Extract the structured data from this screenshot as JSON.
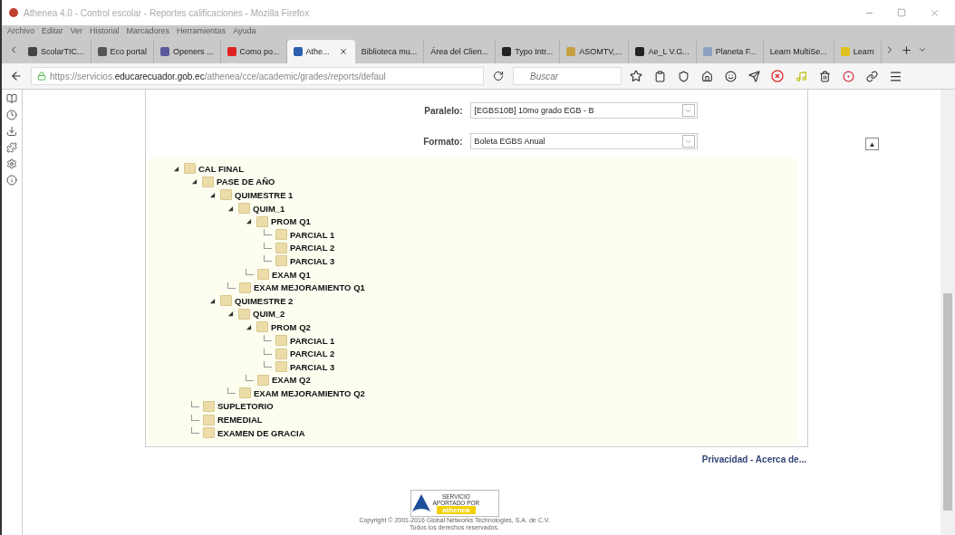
{
  "window": {
    "title": "Athenea 4.0 - Control escolar - Reportes calificaciones - Mozilla Firefox"
  },
  "menu": [
    "Archivo",
    "Editar",
    "Ver",
    "Historial",
    "Marcadores",
    "Herramientas",
    "Ayuda"
  ],
  "tabs": [
    {
      "label": "ScolarTIC...",
      "selected": false,
      "color": "#444444"
    },
    {
      "label": "Eco portal",
      "selected": false,
      "color": "#555555"
    },
    {
      "label": "Openers ...",
      "selected": false,
      "color": "#5a5a9a"
    },
    {
      "label": "Como po...",
      "selected": false,
      "color": "#e02020"
    },
    {
      "label": "Athe...",
      "selected": true,
      "color": "#2a5fb0"
    },
    {
      "label": "Biblioteca mu...",
      "selected": false
    },
    {
      "label": "Área del Clien...",
      "selected": false
    },
    {
      "label": "Typo Intr...",
      "selected": false,
      "color": "#222222"
    },
    {
      "label": "ASOMTV,...",
      "selected": false,
      "color": "#c8a040"
    },
    {
      "label": "Ae_L V.G...",
      "selected": false,
      "color": "#222222"
    },
    {
      "label": "Planeta F...",
      "selected": false,
      "color": "#8aa0c0"
    },
    {
      "label": "Learn MultiSe...",
      "selected": false
    },
    {
      "label": "Learn",
      "selected": false,
      "color": "#e0c020"
    }
  ],
  "address": {
    "prefix": "https://servicios.",
    "domain": "educarecuador.gob.ec",
    "path": "/athenea/cce/academic/grades/reports/defaul"
  },
  "search": {
    "placeholder": "Buscar"
  },
  "form": [
    {
      "label": "Paralelo:",
      "value": "[EGBS10B] 10mo grado EGB - B"
    },
    {
      "label": "Formato:",
      "value": "Boleta EGBS Anual"
    }
  ],
  "tree": [
    {
      "label": "CAL FINAL",
      "expanded": true,
      "children": [
        {
          "label": "PASE DE AÑO",
          "expanded": true,
          "children": [
            {
              "label": "QUIMESTRE 1",
              "expanded": true,
              "children": [
                {
                  "label": "QUIM_1",
                  "expanded": true,
                  "children": [
                    {
                      "label": "PROM Q1",
                      "expanded": true,
                      "children": [
                        {
                          "label": "PARCIAL 1"
                        },
                        {
                          "label": "PARCIAL 2"
                        },
                        {
                          "label": "PARCIAL 3"
                        }
                      ]
                    },
                    {
                      "label": "EXAM Q1"
                    }
                  ]
                },
                {
                  "label": "EXAM MEJORAMIENTO Q1"
                }
              ]
            },
            {
              "label": "QUIMESTRE 2",
              "expanded": true,
              "children": [
                {
                  "label": "QUIM_2",
                  "expanded": true,
                  "children": [
                    {
                      "label": "PROM Q2",
                      "expanded": true,
                      "children": [
                        {
                          "label": "PARCIAL 1"
                        },
                        {
                          "label": "PARCIAL 2"
                        },
                        {
                          "label": "PARCIAL 3"
                        }
                      ]
                    },
                    {
                      "label": "EXAM Q2"
                    }
                  ]
                },
                {
                  "label": "EXAM MEJORAMIENTO Q2"
                }
              ]
            }
          ]
        },
        {
          "label": "SUPLETORIO"
        },
        {
          "label": "REMEDIAL"
        },
        {
          "label": "EXAMEN DE GRACIA"
        }
      ]
    }
  ],
  "top_button": "▲",
  "footer_links": "Privacidad - Acerca de...",
  "badge": {
    "line1": "SERVICIO",
    "line2": "APORTADO POR",
    "brand": "athenea"
  },
  "copyright": [
    "Copyright © 2001-2016 Global Networks Technologies, S.A. de C.V.",
    "Todos los derechos reservados."
  ]
}
